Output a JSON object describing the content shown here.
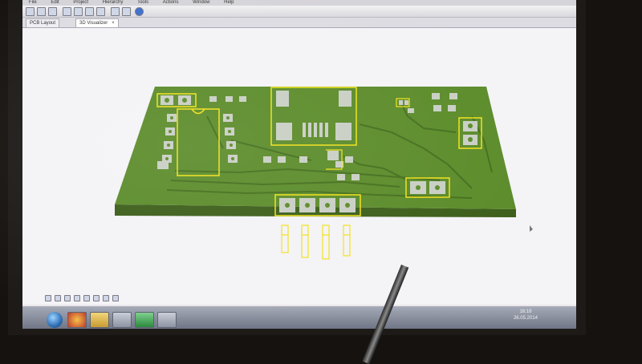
{
  "menubar": {
    "items": [
      "File",
      "Edit",
      "Project",
      "Hierarchy",
      "Tools",
      "Actions",
      "Window",
      "Help"
    ]
  },
  "tabs": [
    {
      "label": "PCB Layout",
      "active": false
    },
    {
      "label": "3D Visualizer",
      "active": true
    }
  ],
  "pcb": {
    "board_color": "#5c8c2b",
    "silkscreen_color": "#f2e21a",
    "pad_color": "#c9cfc4",
    "icons": [
      "pcb-board-3d",
      "dip-footprint",
      "qfn-footprint",
      "pin-header-footprint"
    ]
  },
  "taskbar": {
    "time": "16:18",
    "date": "26.05.2014"
  },
  "colors": {
    "screen_bg": "#f4f3f6",
    "taskbar": "#7a8090"
  }
}
